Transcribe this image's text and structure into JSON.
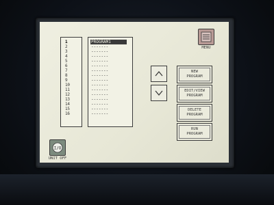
{
  "menu": {
    "label": "MENU",
    "icon": "menu-icon"
  },
  "program_list": {
    "header": "PROGRAM1",
    "numbers": [
      "1",
      "2",
      "3",
      "4",
      "5",
      "6",
      "7",
      "8",
      "9",
      "10",
      "11",
      "12",
      "13",
      "14",
      "15",
      "16"
    ],
    "selected_number": "1",
    "program_names": [
      "-------",
      "-------",
      "-------",
      "-------",
      "-------",
      "-------",
      "-------",
      "-------",
      "-------",
      "-------",
      "-------",
      "-------",
      "-------",
      "-------",
      "-------"
    ]
  },
  "scroll": {
    "up_icon": "chevron-up-icon",
    "down_icon": "chevron-down-icon"
  },
  "commands": [
    {
      "line1": "NEW",
      "line2": "PROGRAM"
    },
    {
      "line1": "EDIT/VIEW",
      "line2": "PROGRAM"
    },
    {
      "line1": "DELETE",
      "line2": "PROGRAM"
    },
    {
      "line1": "RUN",
      "line2": "PROGRAM"
    }
  ],
  "unit": {
    "label": "UNIT OFF",
    "icon": "power-icon",
    "symbol": "I/O"
  }
}
